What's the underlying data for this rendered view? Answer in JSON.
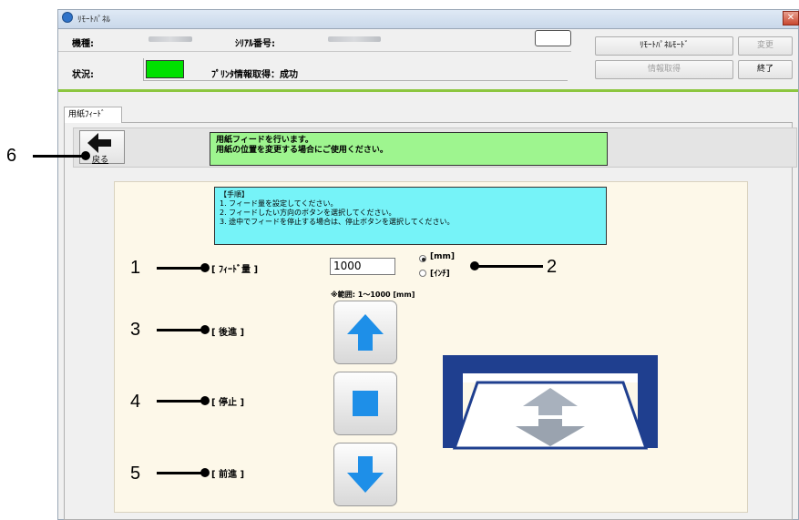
{
  "window": {
    "title": "ﾘﾓｰﾄﾊﾟﾈﾙ",
    "close_label": "✕"
  },
  "header": {
    "model_label": "機種:",
    "serial_label": "ｼﾘｱﾙ番号:",
    "status_label": "状況:",
    "status_text": "ﾌﾟﾘﾝﾀ情報取得：成功",
    "status_color": "#00e000"
  },
  "buttons": {
    "remote_panel_mode": "ﾘﾓｰﾄﾊﾟﾈﾙﾓｰﾄﾞ",
    "change": "変更",
    "get_info": "情報取得",
    "exit": "終了"
  },
  "tab": {
    "label": "用紙ﾌｨｰﾄﾞ"
  },
  "back": {
    "label": "戻る",
    "icon": "arrow-left-icon"
  },
  "info_message": {
    "line1": "用紙フィードを行います。",
    "line2": "用紙の位置を変更する場合にご使用ください。"
  },
  "procedure": {
    "title": "【手順】",
    "steps": [
      "1. フィード量を設定してください。",
      "2. フィードしたい方向のボタンを選択してください。",
      "3. 途中でフィードを停止する場合は、停止ボタンを選択してください。"
    ]
  },
  "feed": {
    "amount_label": "[ ﾌｨｰﾄﾞ量 ]",
    "amount_value": "1000",
    "unit_mm": "[mm]",
    "unit_inch": "[ｲﾝﾁ]",
    "selected_unit": "mm",
    "range_note": "※範囲: 1～1000 [mm]"
  },
  "actions": {
    "backward_label": "[ 後進 ]",
    "stop_label": "[ 停止 ]",
    "forward_label": "[ 前進 ]"
  },
  "callouts": [
    "1",
    "2",
    "3",
    "4",
    "5",
    "6"
  ],
  "colors": {
    "accent_green": "#8cc63f",
    "arrow_blue": "#1e8fe8",
    "printer_navy": "#1f3f8f",
    "info_green": "#9ef58f",
    "procedure_cyan": "#76f3f8"
  }
}
